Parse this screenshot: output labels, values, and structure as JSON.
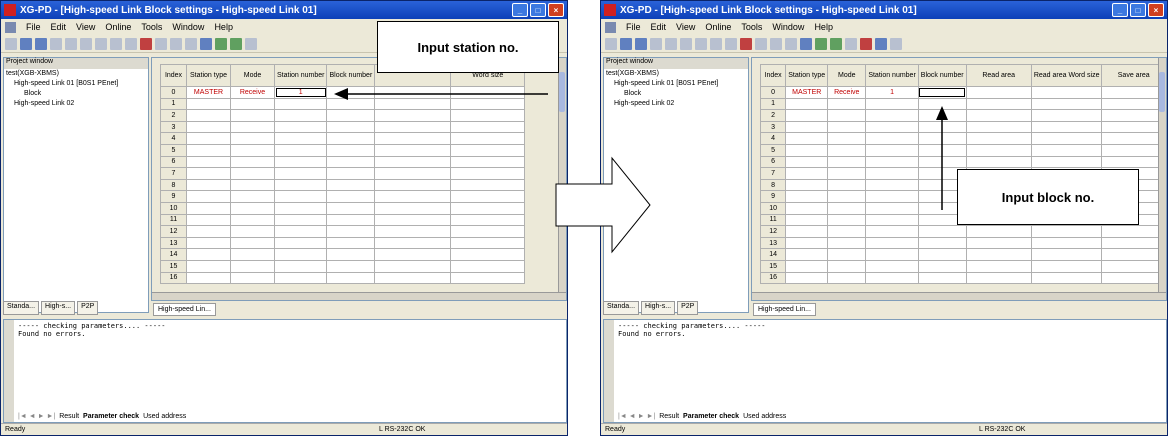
{
  "window": {
    "title": "XG-PD - [High-speed Link Block settings - High-speed Link 01]",
    "menus": [
      "File",
      "Edit",
      "View",
      "Online",
      "Tools",
      "Window",
      "Help"
    ]
  },
  "project": {
    "header": "Project window",
    "tree": [
      "test(XGB-XBMS)",
      "High-speed Link 01 [B0S1 PEnet]",
      "Block",
      "High-speed Link 02"
    ],
    "tabs": [
      "Standa...",
      "High-s...",
      "P2P"
    ]
  },
  "grid": {
    "tab": "High-speed Lin...",
    "columns_win1": [
      "Index",
      "Station type",
      "Mode",
      "Station number",
      "Block number",
      "",
      "Word size"
    ],
    "columns_win2": [
      "Index",
      "Station type",
      "Mode",
      "Station number",
      "Block number",
      "Read area",
      "Read area Word size",
      "Save area"
    ],
    "row0": {
      "index": "0",
      "station_type": "MASTER",
      "mode": "Receive",
      "station_number": "1"
    },
    "indices": [
      "0",
      "1",
      "2",
      "3",
      "4",
      "5",
      "6",
      "7",
      "8",
      "9",
      "10",
      "11",
      "12",
      "13",
      "14",
      "15",
      "16"
    ]
  },
  "messages": {
    "lines": [
      "----- checking parameters.... -----",
      "Found no errors."
    ],
    "tabs": [
      "Result",
      "Parameter check",
      "Used address"
    ]
  },
  "status": {
    "left": "Ready",
    "port": "L RS-232C OK"
  },
  "callouts": {
    "station": "Input station no.",
    "block": "Input block no."
  },
  "colors": {
    "accent": "#0c40b8",
    "receive_text": "#c00000"
  }
}
